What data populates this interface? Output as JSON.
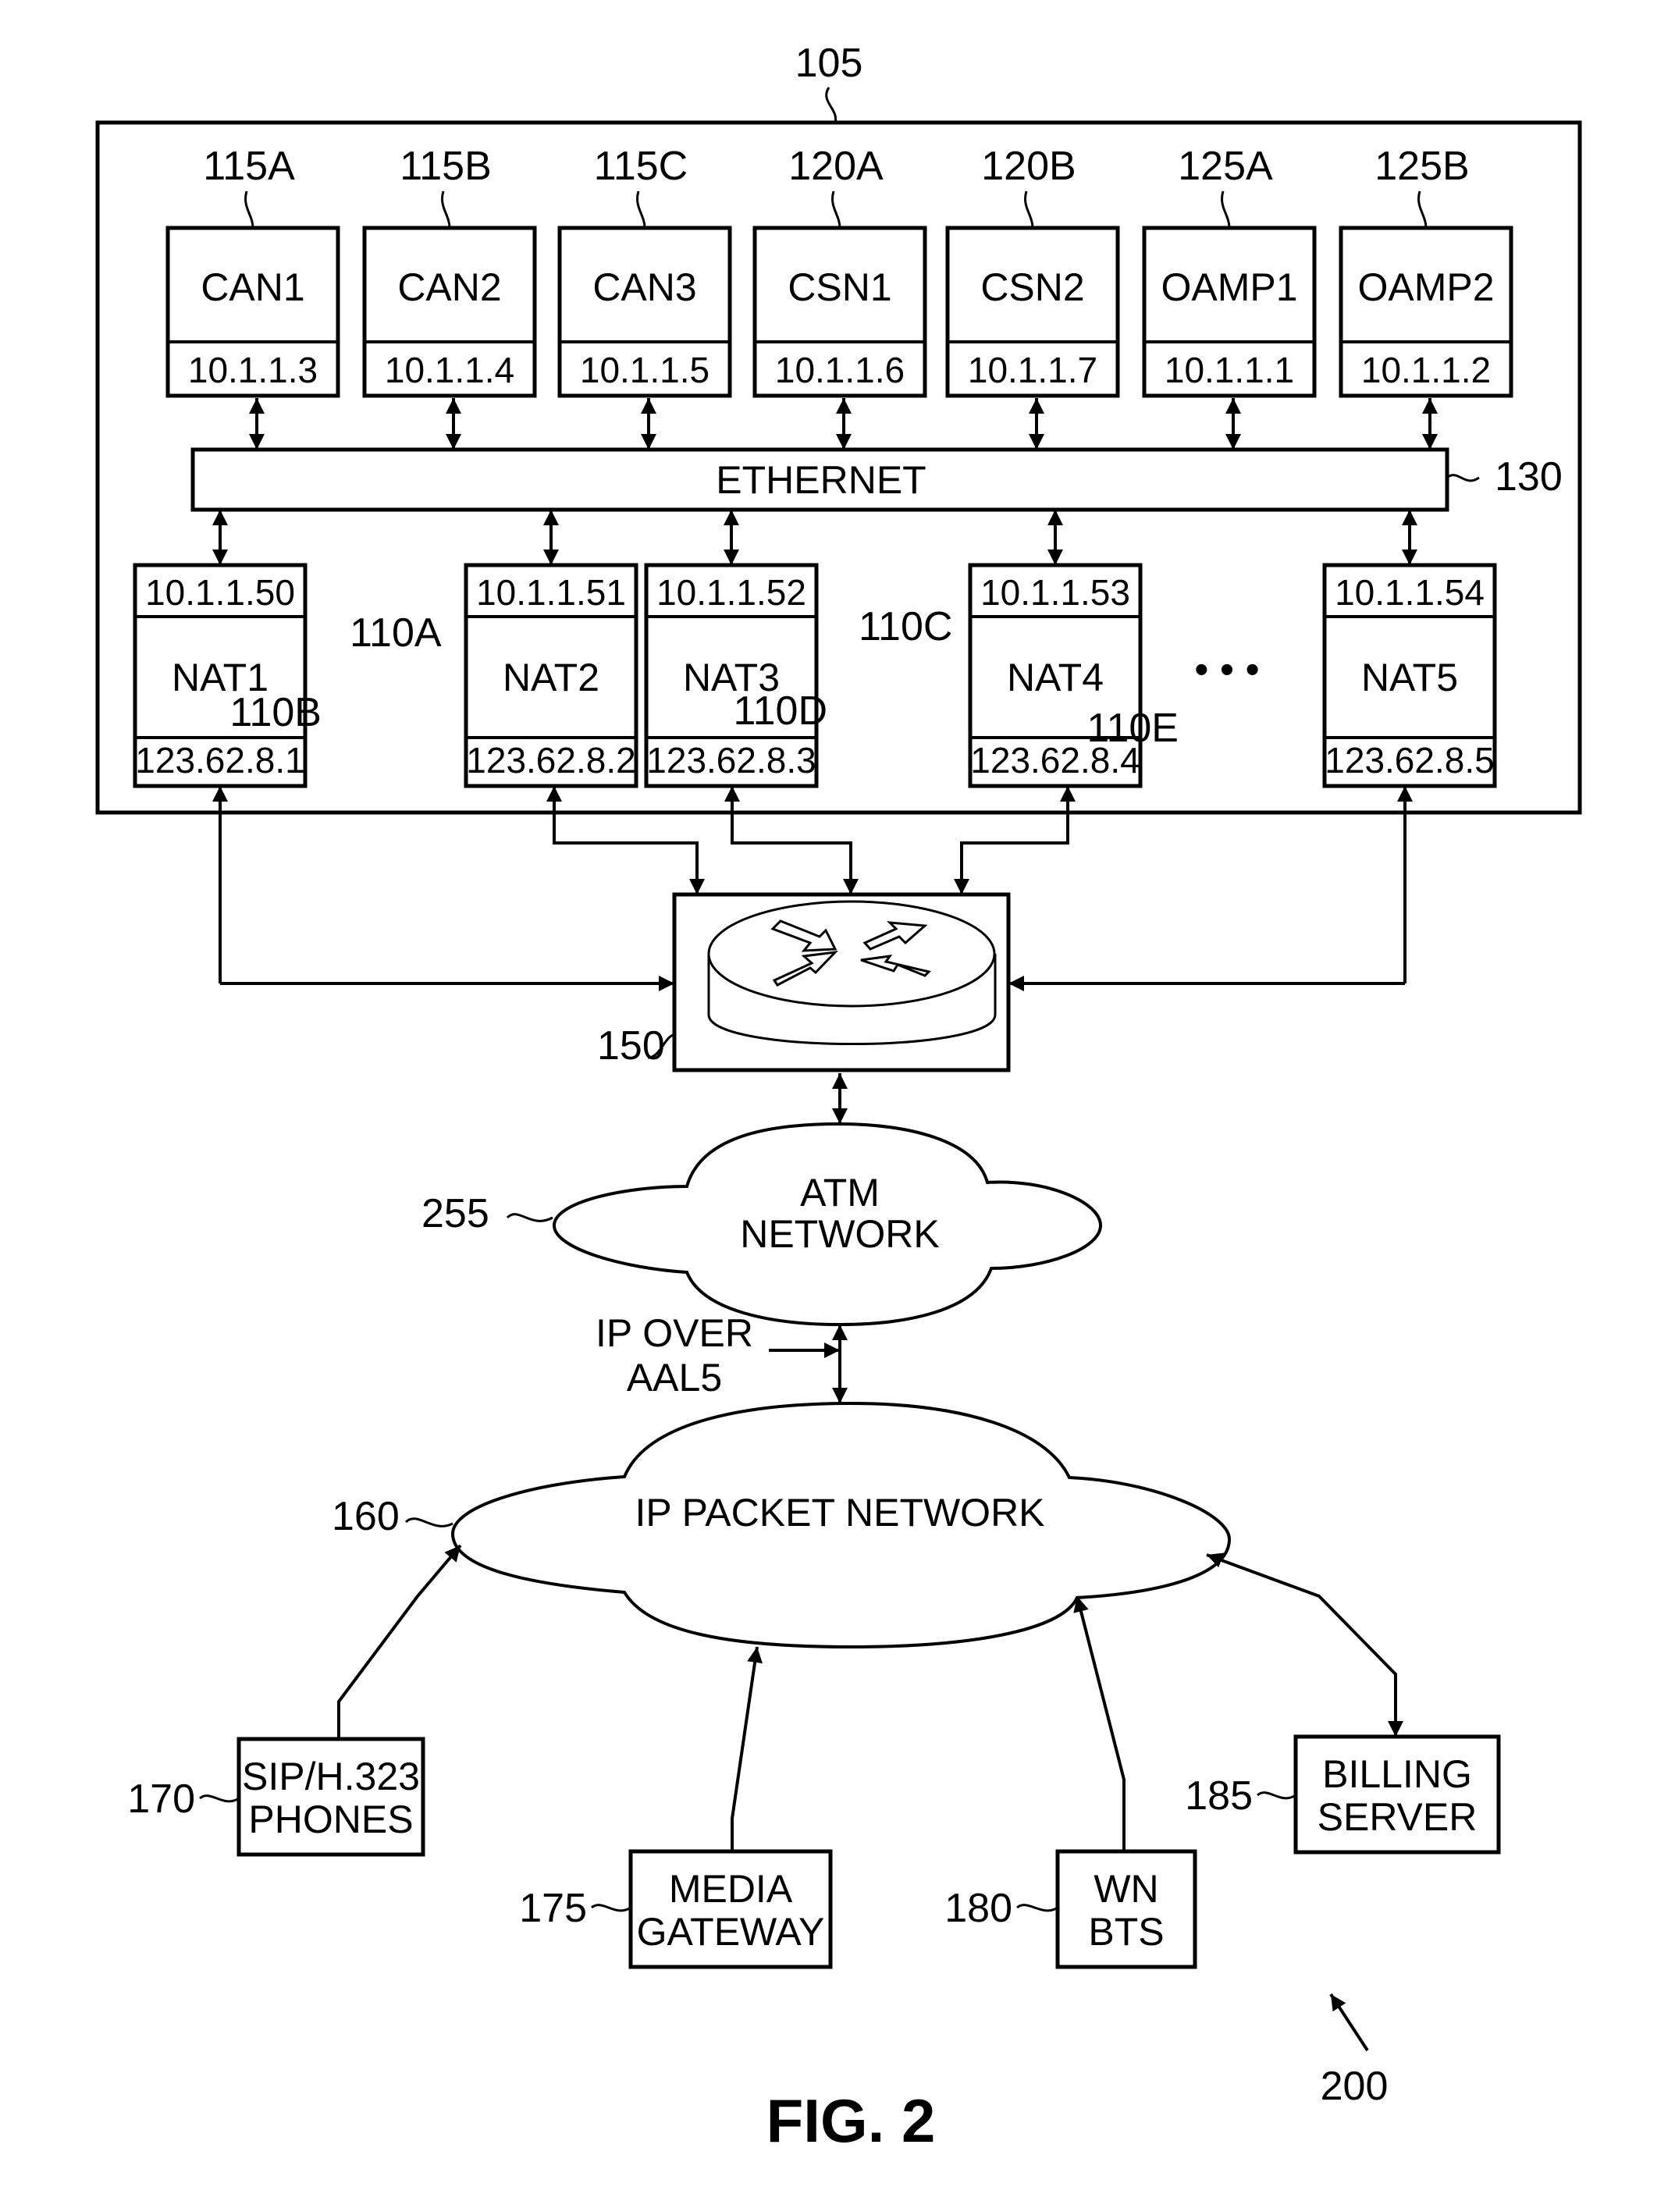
{
  "figure": {
    "title": "FIG. 2",
    "system_ref": "200"
  },
  "enclosure": {
    "ref": "105"
  },
  "servers": [
    {
      "ref": "115A",
      "name": "CAN1",
      "ip": "10.1.1.3"
    },
    {
      "ref": "115B",
      "name": "CAN2",
      "ip": "10.1.1.4"
    },
    {
      "ref": "115C",
      "name": "CAN3",
      "ip": "10.1.1.5"
    },
    {
      "ref": "120A",
      "name": "CSN1",
      "ip": "10.1.1.6"
    },
    {
      "ref": "120B",
      "name": "CSN2",
      "ip": "10.1.1.7"
    },
    {
      "ref": "125A",
      "name": "OAMP1",
      "ip": "10.1.1.1"
    },
    {
      "ref": "125B",
      "name": "OAMP2",
      "ip": "10.1.1.2"
    }
  ],
  "ethernet": {
    "label": "ETHERNET",
    "ref": "130"
  },
  "nats": [
    {
      "ref": "110A",
      "name": "NAT1",
      "private_ip": "10.1.1.50",
      "public_ip": "123.62.8.1"
    },
    {
      "ref": "110B",
      "name": "NAT2",
      "private_ip": "10.1.1.51",
      "public_ip": "123.62.8.2"
    },
    {
      "ref": "110C",
      "name": "NAT3",
      "private_ip": "10.1.1.52",
      "public_ip": "123.62.8.3"
    },
    {
      "ref": "110D",
      "name": "NAT4",
      "private_ip": "10.1.1.53",
      "public_ip": "123.62.8.4"
    },
    {
      "ref": "110E",
      "name": "NAT5",
      "private_ip": "10.1.1.54",
      "public_ip": "123.62.8.5"
    }
  ],
  "ellipsis": "• • •",
  "router": {
    "ref": "150",
    "icon": "router-icon"
  },
  "atm_network": {
    "ref": "255",
    "line1": "ATM",
    "line2": "NETWORK"
  },
  "link_label": {
    "line1": "IP OVER",
    "line2": "AAL5"
  },
  "ip_network": {
    "ref": "160",
    "label": "IP PACKET NETWORK"
  },
  "endpoints": [
    {
      "ref": "170",
      "line1": "SIP/H.323",
      "line2": "PHONES"
    },
    {
      "ref": "175",
      "line1": "MEDIA",
      "line2": "GATEWAY"
    },
    {
      "ref": "180",
      "line1": "WN",
      "line2": "BTS"
    },
    {
      "ref": "185",
      "line1": "BILLING",
      "line2": "SERVER"
    }
  ]
}
